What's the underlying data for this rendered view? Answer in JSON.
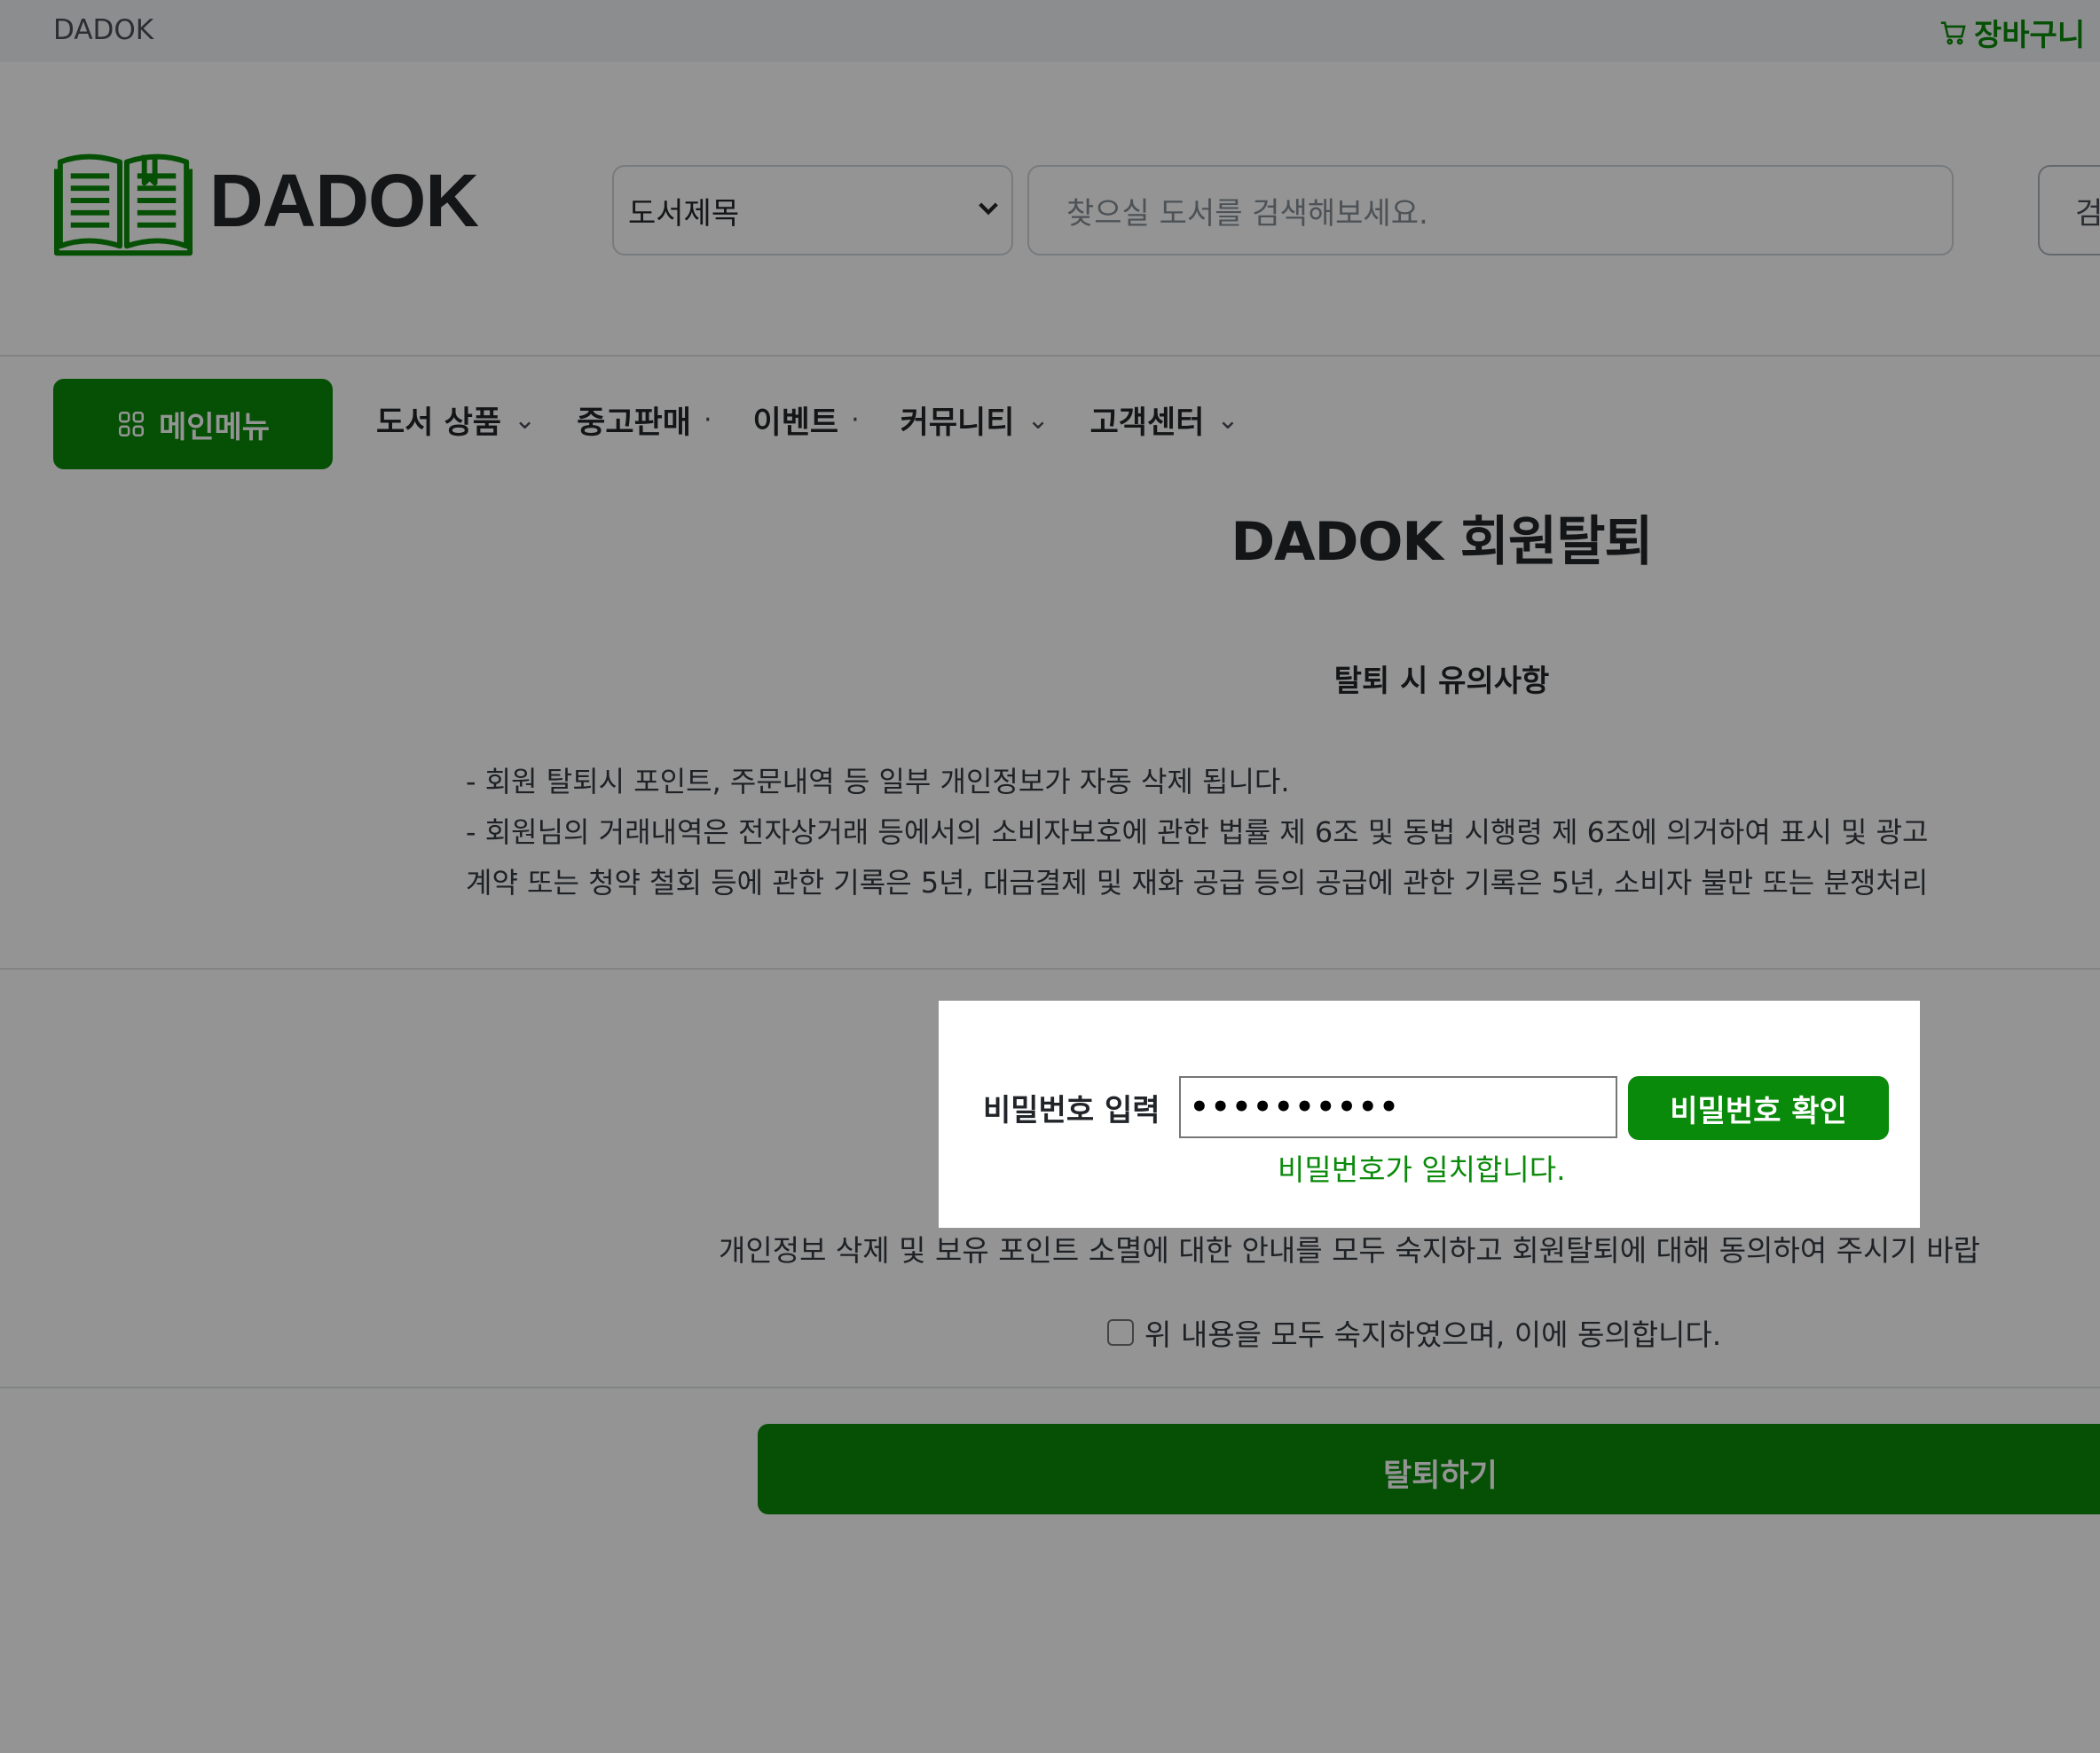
{
  "topbar": {
    "brand": "DADOK",
    "cart_label": "장바구니",
    "cart_icon": "cart-icon"
  },
  "header": {
    "logo_text": "DADOK",
    "logo_icon": "open-book-icon",
    "category_select": {
      "selected": "도서제목"
    },
    "search": {
      "placeholder": "찾으실 도서를 검색해보세요.",
      "button_label": "검색"
    }
  },
  "nav": {
    "main_menu": "메인메뉴",
    "main_menu_icon": "grid-icon",
    "items": [
      {
        "label": "도서 상품",
        "indicator": "⌄"
      },
      {
        "label": "중고판매",
        "indicator": "·"
      },
      {
        "label": "이벤트",
        "indicator": "·"
      },
      {
        "label": "커뮤니티",
        "indicator": "⌄"
      },
      {
        "label": "고객센터",
        "indicator": "⌄"
      }
    ]
  },
  "content": {
    "title": "DADOK 회원탈퇴",
    "notice_title": "탈퇴 시 유의사항",
    "notice_lines": [
      "- 회원 탈퇴시 포인트, 주문내역 등 일부 개인정보가 자동 삭제 됩니다.",
      "- 회원님의 거래내역은 전자상거래 등에서의 소비자보호에 관한 법률 제 6조 및 동법 시행령 제 6조에 의거하여 표시 및 광고",
      "계약 또는 청약 철회 등에 관한 기록은 5년, 대금결제 및 재화 공급 등의 공급에 관한 기록은 5년, 소비자 불만 또는 분쟁처리"
    ],
    "password": {
      "label": "비밀번호 입력",
      "value": "••••••••••",
      "confirm_button": "비밀번호 확인",
      "match_message": "비밀번호가 일치합니다."
    },
    "agree_text": "개인정보 삭제 및 보유 포인트 소멸에 대한 안내를 모두 숙지하고 회원탈퇴에 대해 동의하여 주시기 바랍",
    "agree_checkbox_label": "위 내용을 모두 숙지하였으며, 이에 동의합니다.",
    "withdraw_button": "탈퇴하기"
  },
  "colors": {
    "accent": "#0a8a0a",
    "overlay": "rgba(0,0,0,0.42)"
  }
}
